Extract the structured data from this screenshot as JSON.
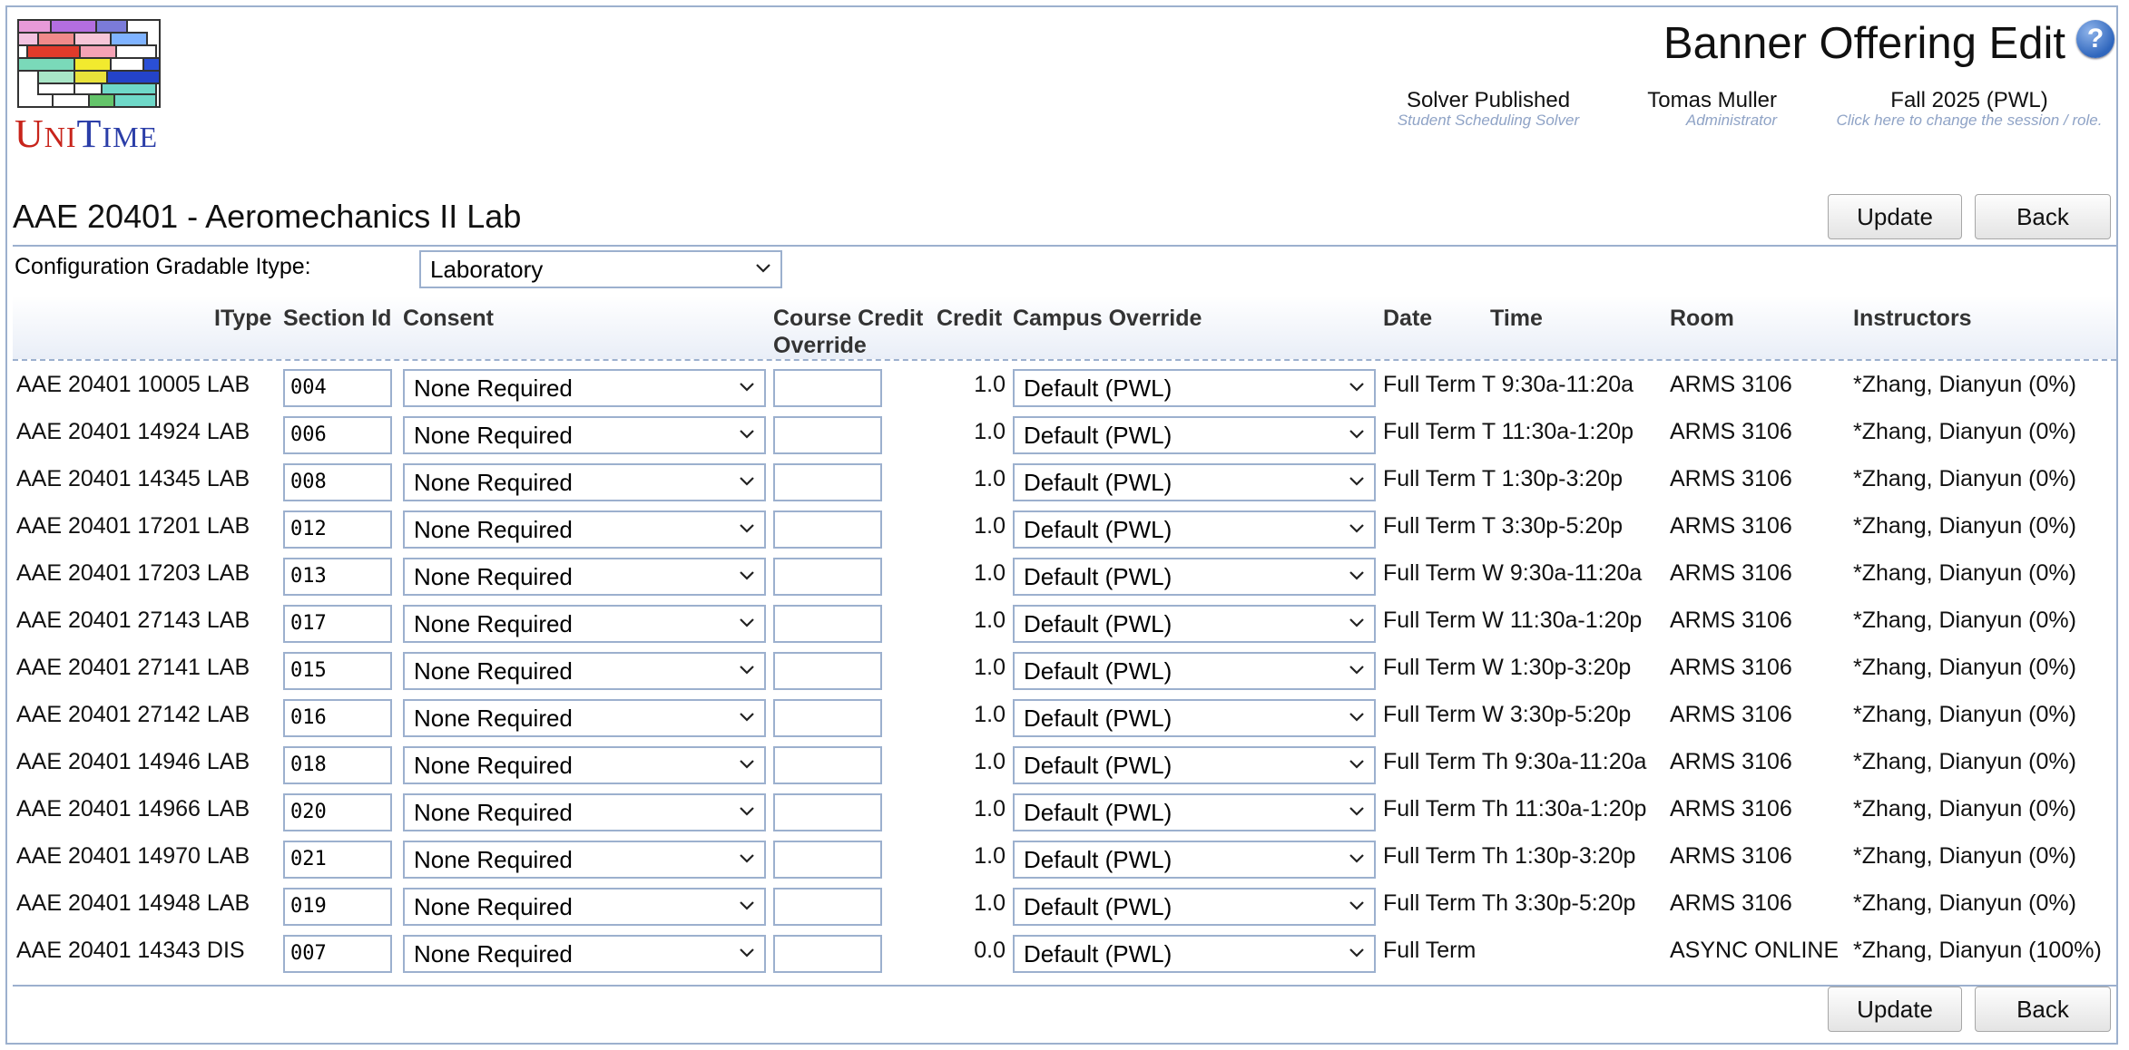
{
  "app": {
    "logo_text": "UniTime",
    "help_icon": "?"
  },
  "page": {
    "title": "Banner Offering Edit"
  },
  "header": {
    "solver": {
      "main": "Solver Published",
      "sub": "Student Scheduling Solver"
    },
    "user": {
      "main": "Tomas Muller",
      "sub": "Administrator"
    },
    "session": {
      "main": "Fall 2025 (PWL)",
      "sub": "Click here to change the session / role."
    }
  },
  "course": {
    "title": "AAE 20401 - Aeromechanics II Lab"
  },
  "buttons": {
    "update": "Update",
    "back": "Back"
  },
  "config": {
    "label": "Configuration Gradable Itype:",
    "value": "Laboratory"
  },
  "table": {
    "headers": {
      "itype": "IType",
      "section_id": "Section Id",
      "consent": "Consent",
      "course_credit_line1": "Course Credit",
      "course_credit_line2": "Override",
      "credit": "Credit",
      "campus_override": "Campus Override",
      "date": "Date",
      "time": "Time",
      "room": "Room",
      "instructors": "Instructors"
    },
    "rows": [
      {
        "itype": "AAE 20401 10005 LAB",
        "section_id": "004",
        "consent": "None Required",
        "credit_override": "",
        "credit": "1.0",
        "campus": "Default (PWL)",
        "datetime": "Full Term T 9:30a-11:20a",
        "room": "ARMS 3106",
        "instructors": "*Zhang, Dianyun (0%)"
      },
      {
        "itype": "AAE 20401 14924 LAB",
        "section_id": "006",
        "consent": "None Required",
        "credit_override": "",
        "credit": "1.0",
        "campus": "Default (PWL)",
        "datetime": "Full Term T 11:30a-1:20p",
        "room": "ARMS 3106",
        "instructors": "*Zhang, Dianyun (0%)"
      },
      {
        "itype": "AAE 20401 14345 LAB",
        "section_id": "008",
        "consent": "None Required",
        "credit_override": "",
        "credit": "1.0",
        "campus": "Default (PWL)",
        "datetime": "Full Term T 1:30p-3:20p",
        "room": "ARMS 3106",
        "instructors": "*Zhang, Dianyun (0%)"
      },
      {
        "itype": "AAE 20401 17201 LAB",
        "section_id": "012",
        "consent": "None Required",
        "credit_override": "",
        "credit": "1.0",
        "campus": "Default (PWL)",
        "datetime": "Full Term T 3:30p-5:20p",
        "room": "ARMS 3106",
        "instructors": "*Zhang, Dianyun (0%)"
      },
      {
        "itype": "AAE 20401 17203 LAB",
        "section_id": "013",
        "consent": "None Required",
        "credit_override": "",
        "credit": "1.0",
        "campus": "Default (PWL)",
        "datetime": "Full Term W 9:30a-11:20a",
        "room": "ARMS 3106",
        "instructors": "*Zhang, Dianyun (0%)"
      },
      {
        "itype": "AAE 20401 27143 LAB",
        "section_id": "017",
        "consent": "None Required",
        "credit_override": "",
        "credit": "1.0",
        "campus": "Default (PWL)",
        "datetime": "Full Term W 11:30a-1:20p",
        "room": "ARMS 3106",
        "instructors": "*Zhang, Dianyun (0%)"
      },
      {
        "itype": "AAE 20401 27141 LAB",
        "section_id": "015",
        "consent": "None Required",
        "credit_override": "",
        "credit": "1.0",
        "campus": "Default (PWL)",
        "datetime": "Full Term W 1:30p-3:20p",
        "room": "ARMS 3106",
        "instructors": "*Zhang, Dianyun (0%)"
      },
      {
        "itype": "AAE 20401 27142 LAB",
        "section_id": "016",
        "consent": "None Required",
        "credit_override": "",
        "credit": "1.0",
        "campus": "Default (PWL)",
        "datetime": "Full Term W 3:30p-5:20p",
        "room": "ARMS 3106",
        "instructors": "*Zhang, Dianyun (0%)"
      },
      {
        "itype": "AAE 20401 14946 LAB",
        "section_id": "018",
        "consent": "None Required",
        "credit_override": "",
        "credit": "1.0",
        "campus": "Default (PWL)",
        "datetime": "Full Term Th 9:30a-11:20a",
        "room": "ARMS 3106",
        "instructors": "*Zhang, Dianyun (0%)"
      },
      {
        "itype": "AAE 20401 14966 LAB",
        "section_id": "020",
        "consent": "None Required",
        "credit_override": "",
        "credit": "1.0",
        "campus": "Default (PWL)",
        "datetime": "Full Term Th 11:30a-1:20p",
        "room": "ARMS 3106",
        "instructors": "*Zhang, Dianyun (0%)"
      },
      {
        "itype": "AAE 20401 14970 LAB",
        "section_id": "021",
        "consent": "None Required",
        "credit_override": "",
        "credit": "1.0",
        "campus": "Default (PWL)",
        "datetime": "Full Term Th 1:30p-3:20p",
        "room": "ARMS 3106",
        "instructors": "*Zhang, Dianyun (0%)"
      },
      {
        "itype": "AAE 20401 14948 LAB",
        "section_id": "019",
        "consent": "None Required",
        "credit_override": "",
        "credit": "1.0",
        "campus": "Default (PWL)",
        "datetime": "Full Term Th 3:30p-5:20p",
        "room": "ARMS 3106",
        "instructors": "*Zhang, Dianyun (0%)"
      },
      {
        "itype": "AAE 20401 14343 DIS",
        "section_id": "007",
        "consent": "None Required",
        "credit_override": "",
        "credit": "0.0",
        "campus": "Default (PWL)",
        "datetime": "Full Term",
        "room": "ASYNC ONLINE",
        "instructors": "*Zhang, Dianyun (100%)"
      }
    ]
  },
  "colors": {
    "border": "#9cb0ce",
    "subtext": "#8fa3c6",
    "help": "#2f66bd"
  }
}
